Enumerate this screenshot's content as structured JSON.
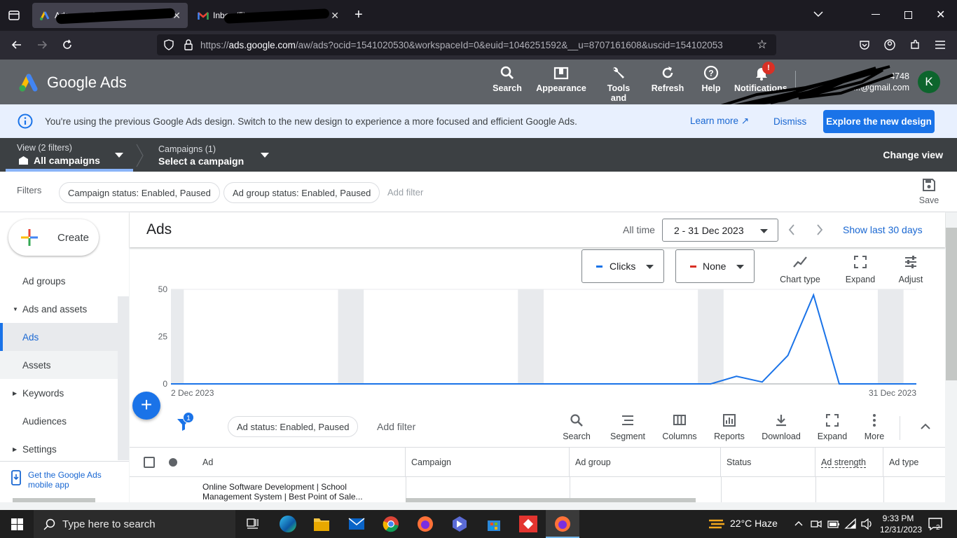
{
  "browser": {
    "tabs": [
      {
        "title": "Ads - ... - Google Ads"
      },
      {
        "title": "Inbox (5) - ...@gmail.com"
      }
    ],
    "url_gray": "https://",
    "url_host": "ads.google.com",
    "url_path": "/aw/ads?ocid=1541020530&workspaceId=0&euid=1046251592&__u=8707161608&uscid=154102053"
  },
  "header": {
    "product": "Google Ads",
    "nav": [
      {
        "label": "Search",
        "icon": "search-icon"
      },
      {
        "label": "Appearance",
        "icon": "appearance-icon"
      },
      {
        "label": "Tools and",
        "icon": "wrench-icon"
      },
      {
        "label": "Refresh",
        "icon": "refresh-icon"
      },
      {
        "label": "Help",
        "icon": "help-icon"
      },
      {
        "label": "Notifications",
        "icon": "bell-icon",
        "badge": "!"
      }
    ],
    "account_id": "4748",
    "account_email": "...@gmail.com",
    "avatar_letter": "K",
    "avatar_color": "#0d652d"
  },
  "banner": {
    "message": "You're using the previous Google Ads design. Switch to the new design to experience a more focused and efficient Google Ads.",
    "learn_more": "Learn more",
    "dismiss": "Dismiss",
    "explore": "Explore the new design"
  },
  "context": {
    "view_label": "View (2 filters)",
    "view_value": "All campaigns",
    "campaigns_label": "Campaigns (1)",
    "campaigns_value": "Select a campaign",
    "change_view": "Change view"
  },
  "filters": {
    "label": "Filters",
    "chips": [
      "Campaign status: Enabled, Paused",
      "Ad group status: Enabled, Paused"
    ],
    "add_filter": "Add filter",
    "save": "Save"
  },
  "sidebar": {
    "create": "Create",
    "items": [
      {
        "label": "Ad groups"
      },
      {
        "label": "Ads and assets",
        "expanded": true
      },
      {
        "label": "Ads",
        "active": true
      },
      {
        "label": "Assets"
      },
      {
        "label": "Keywords"
      },
      {
        "label": "Audiences"
      },
      {
        "label": "Settings"
      }
    ],
    "mobile_app": "Get the Google Ads mobile app"
  },
  "page": {
    "title": "Ads",
    "range_label": "All time",
    "date_range": "2 - 31 Dec 2023",
    "show_last": "Show last 30 days"
  },
  "chart_controls": {
    "metric1": "Clicks",
    "metric1_color": "#1a73e8",
    "metric2": "None",
    "metric2_color": "#d93025",
    "chart_type": "Chart type",
    "expand": "Expand",
    "adjust": "Adjust"
  },
  "chart_data": {
    "type": "line",
    "x_start": "2 Dec 2023",
    "x_end": "31 Dec 2023",
    "yticks": [
      "50",
      "25",
      "0"
    ],
    "ylim": [
      0,
      50
    ],
    "series": [
      {
        "values": [
          0,
          0,
          0,
          0,
          0,
          0,
          0,
          0,
          0,
          0,
          0,
          0,
          0,
          0,
          0,
          0,
          0,
          0,
          0,
          0,
          0,
          0,
          4,
          1,
          15,
          47,
          0,
          0,
          0,
          0
        ]
      }
    ]
  },
  "table_toolbar": {
    "filter_badge": "1",
    "chip": "Ad status: Enabled, Paused",
    "add_filter": "Add filter",
    "buttons": [
      "Search",
      "Segment",
      "Columns",
      "Reports",
      "Download",
      "Expand",
      "More"
    ]
  },
  "table": {
    "headers": [
      "Ad",
      "Campaign",
      "Ad group",
      "Status",
      "Ad strength",
      "Ad type"
    ],
    "rows": [
      {
        "ad": "Online Software Development | School Management System | Best Point of Sale..."
      }
    ]
  },
  "taskbar": {
    "search_placeholder": "Type here to search",
    "weather": "22°C  Haze",
    "time": "9:33 PM",
    "date": "12/31/2023",
    "notif_count": "2"
  }
}
